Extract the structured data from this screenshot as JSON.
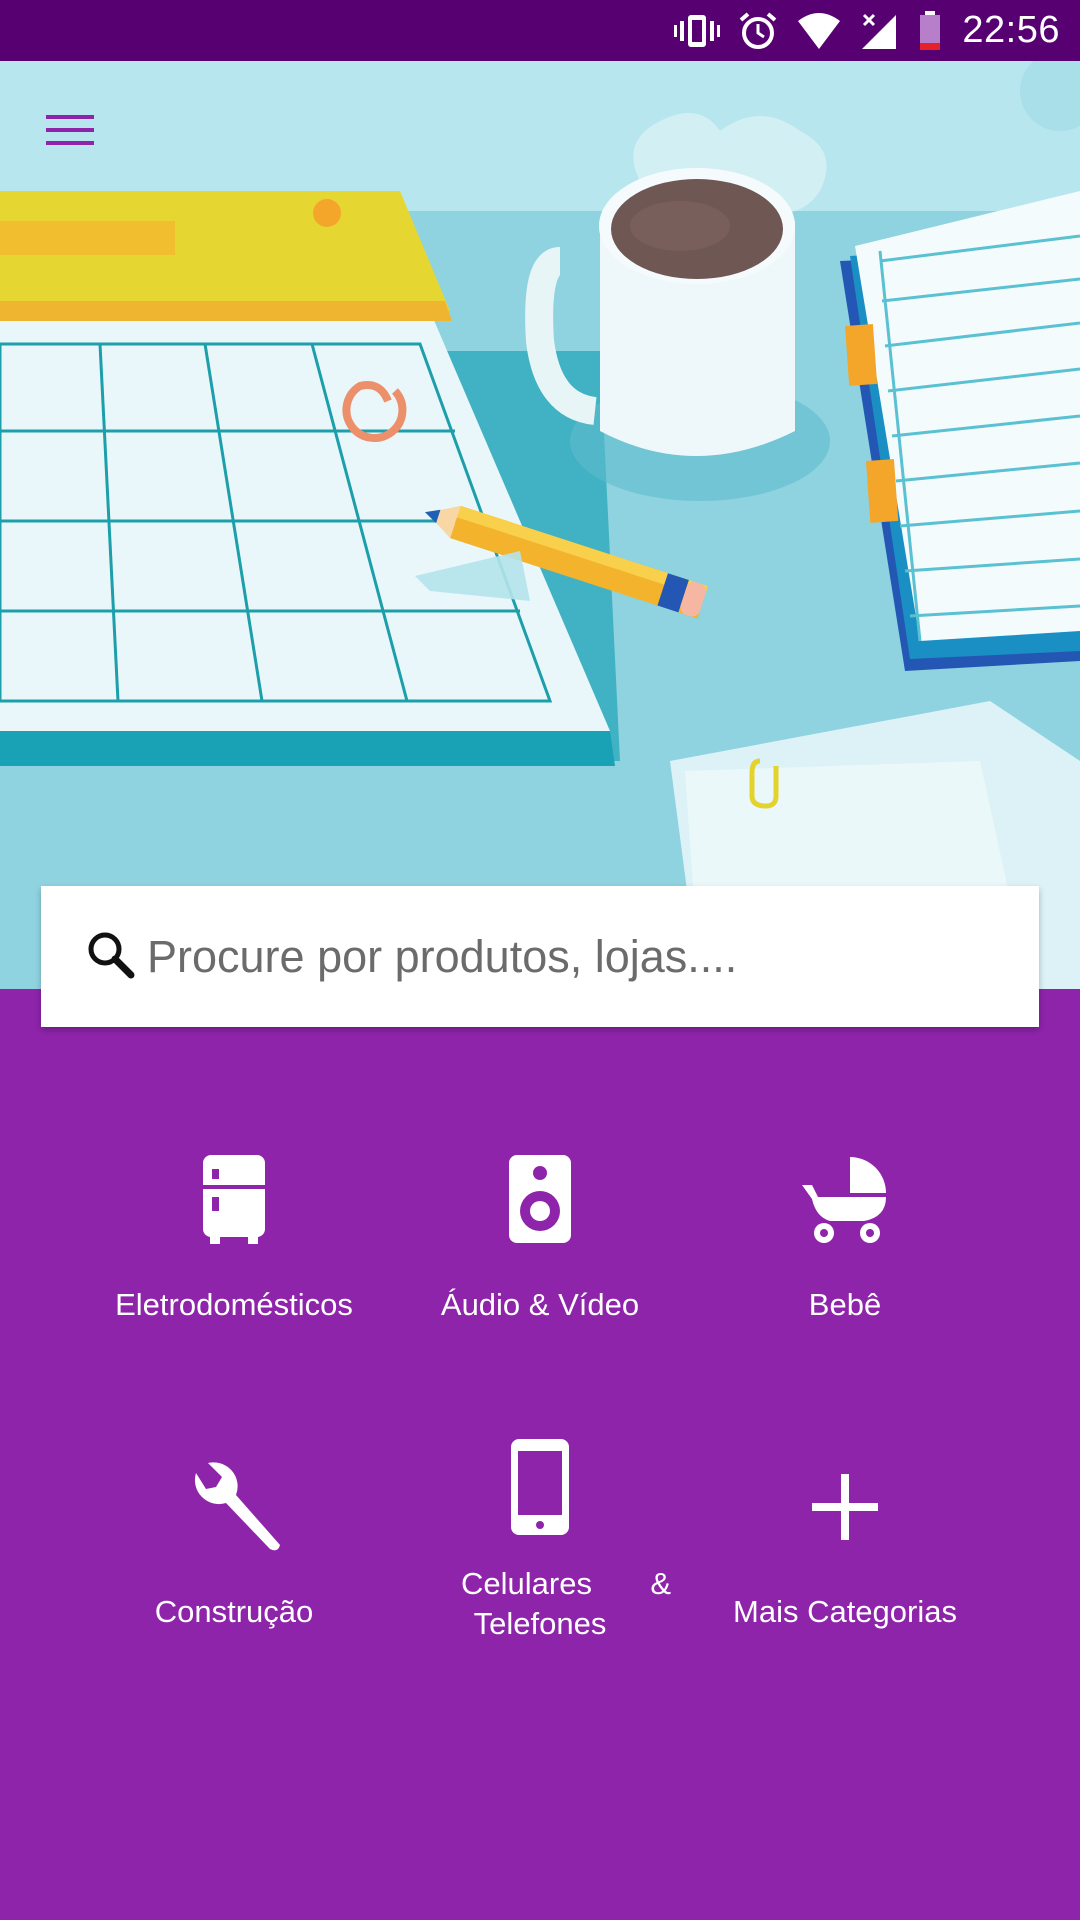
{
  "status_bar": {
    "time": "22:56",
    "icons": [
      "vibrate-icon",
      "alarm-icon",
      "wifi-icon",
      "signal-icon",
      "battery-low-icon"
    ]
  },
  "header": {
    "menu_icon": "hamburger-menu-icon"
  },
  "search": {
    "placeholder": "Procure por produtos, lojas....",
    "value": "",
    "icon": "search-icon"
  },
  "categories": [
    {
      "label": "Eletrodomésticos",
      "icon": "fridge-icon"
    },
    {
      "label": "Áudio & Vídeo",
      "icon": "speaker-icon"
    },
    {
      "label": "Bebê",
      "icon": "baby-stroller-icon"
    },
    {
      "label": "Construção",
      "icon": "wrench-icon"
    },
    {
      "label_part1": "Celulares",
      "label_part2": "&",
      "label_part3": "Telefones",
      "icon": "smartphone-icon"
    },
    {
      "label": "Mais Categorias",
      "icon": "plus-icon"
    }
  ],
  "colors": {
    "status_bar": "#570072",
    "primary": "#8e24aa",
    "hero_bg": "#9ad9e5",
    "icon_fg": "#ffffff"
  }
}
